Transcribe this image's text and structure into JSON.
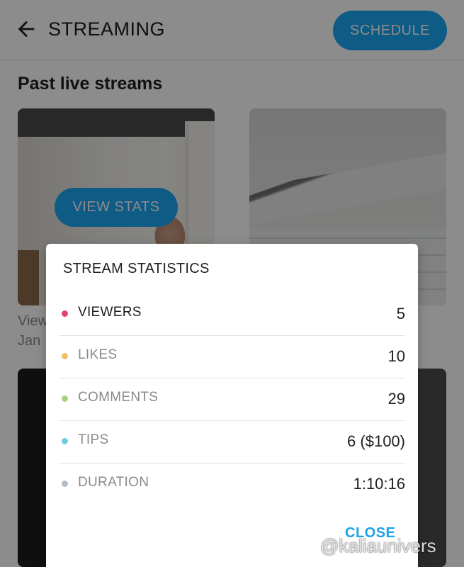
{
  "header": {
    "back_icon": "arrow-left-icon",
    "title": "STREAMING",
    "schedule_label": "SCHEDULE"
  },
  "section_title": "Past live streams",
  "streams": [
    {
      "view_stats_label": "VIEW STATS",
      "caption_line_1": "View",
      "caption_line_2": "Jan"
    }
  ],
  "dialog": {
    "title": "STREAM STATISTICS",
    "stats": [
      {
        "label": "VIEWERS",
        "value": "5",
        "dot_color": "#e2446e"
      },
      {
        "label": "LIKES",
        "value": "10",
        "dot_color": "#f3c069"
      },
      {
        "label": "COMMENTS",
        "value": "29",
        "dot_color": "#a7d37e"
      },
      {
        "label": "TIPS",
        "value": "6 ($100)",
        "dot_color": "#6fcde0"
      },
      {
        "label": "DURATION",
        "value": "1:10:16",
        "dot_color": "#b5bec6"
      }
    ],
    "close_label": "CLOSE"
  },
  "watermark": "@kaliaunivers",
  "colors": {
    "accent": "#1ba6f2",
    "close": "#1aa3e8"
  }
}
